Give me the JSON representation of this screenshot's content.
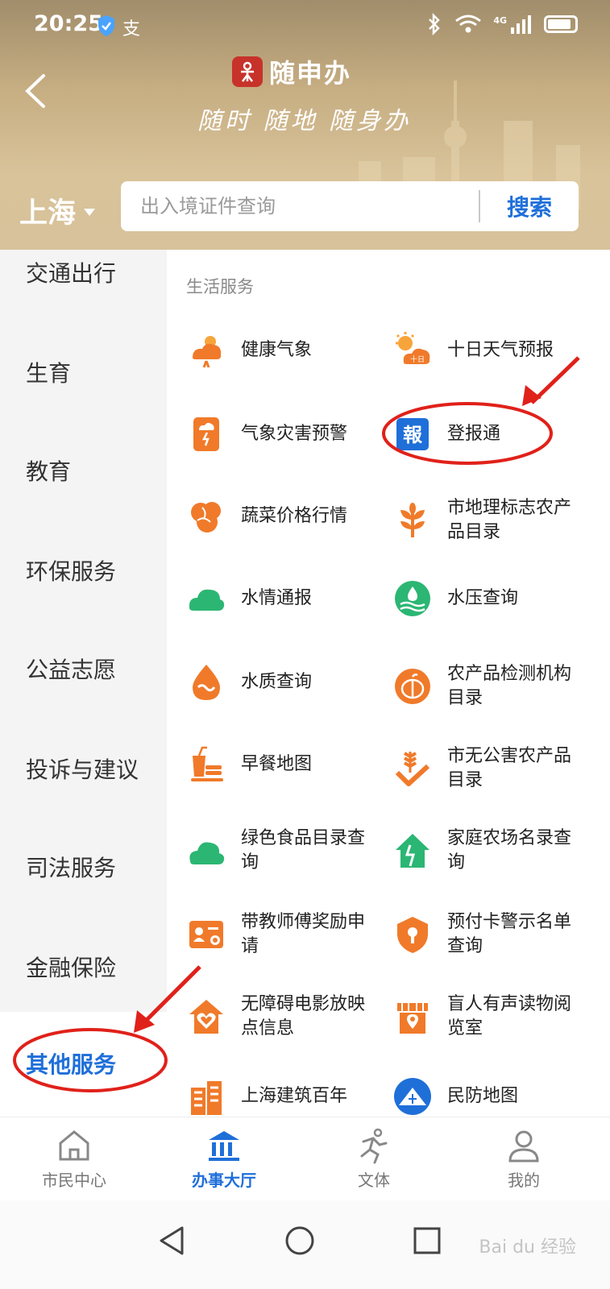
{
  "status_bar": {
    "time": "20:25",
    "alipay_glyph": "支",
    "network": "4G"
  },
  "header": {
    "app_name": "随申办",
    "slogan": "随时 随地 随身办",
    "city": "上海",
    "search_placeholder": "出入境证件查询",
    "search_button": "搜索"
  },
  "sidebar": {
    "items": [
      {
        "label": "交通出行"
      },
      {
        "label": "生育"
      },
      {
        "label": "教育"
      },
      {
        "label": "环保服务"
      },
      {
        "label": "公益志愿"
      },
      {
        "label": "投诉与建议"
      },
      {
        "label": "司法服务"
      },
      {
        "label": "金融保险"
      },
      {
        "label": "其他服务",
        "active": true
      }
    ]
  },
  "main": {
    "section_title": "生活服务",
    "services": [
      {
        "label": "健康气象",
        "icon": "cloud-sun-rain-icon",
        "color": "#f07a2a"
      },
      {
        "label": "十日天气预报",
        "icon": "sun-cloud-10day-icon",
        "color": "#f07a2a"
      },
      {
        "label": "气象灾害预警",
        "icon": "weather-warning-icon",
        "color": "#f07a2a"
      },
      {
        "label": "登报通",
        "icon": "newspaper-bao-icon",
        "color": "#1f6fd9"
      },
      {
        "label": "蔬菜价格行情",
        "icon": "vegetable-icon",
        "color": "#f07a2a"
      },
      {
        "label": "市地理标志农产品目录",
        "icon": "leaf-sprout-icon",
        "color": "#f07a2a"
      },
      {
        "label": "水情通报",
        "icon": "cloud-icon",
        "color": "#2bb673"
      },
      {
        "label": "水压查询",
        "icon": "water-pressure-icon",
        "color": "#2bb673"
      },
      {
        "label": "水质查询",
        "icon": "water-drop-icon",
        "color": "#f07a2a"
      },
      {
        "label": "农产品检测机构目录",
        "icon": "pumpkin-icon",
        "color": "#f07a2a"
      },
      {
        "label": "早餐地图",
        "icon": "breakfast-icon",
        "color": "#f07a2a"
      },
      {
        "label": "市无公害农产品目录",
        "icon": "wheat-hand-icon",
        "color": "#f07a2a"
      },
      {
        "label": "绿色食品目录查询",
        "icon": "green-cloud-icon",
        "color": "#2bb673"
      },
      {
        "label": "家庭农场名录查询",
        "icon": "farm-house-icon",
        "color": "#2bb673"
      },
      {
        "label": "带教师傅奖励申请",
        "icon": "id-card-icon",
        "color": "#f07a2a"
      },
      {
        "label": "预付卡警示名单查询",
        "icon": "shield-lock-icon",
        "color": "#f07a2a"
      },
      {
        "label": "无障碍电影放映点信息",
        "icon": "heart-home-icon",
        "color": "#f07a2a"
      },
      {
        "label": "盲人有声读物阅览室",
        "icon": "store-pin-icon",
        "color": "#f07a2a"
      },
      {
        "label": "上海建筑百年",
        "icon": "building-icon",
        "color": "#f07a2a"
      },
      {
        "label": "民防地图",
        "icon": "civil-defense-icon",
        "color": "#1f6fd9"
      }
    ]
  },
  "bottom_nav": [
    {
      "label": "市民中心",
      "icon": "home-icon"
    },
    {
      "label": "办事大厅",
      "icon": "bank-hall-icon",
      "active": true
    },
    {
      "label": "文体",
      "icon": "runner-icon"
    },
    {
      "label": "我的",
      "icon": "user-icon"
    }
  ],
  "colors": {
    "accent": "#1f6fd9",
    "orange": "#f07a2a",
    "green": "#2bb673",
    "annotation": "#e0211a"
  },
  "watermark": "Bai du 经验"
}
